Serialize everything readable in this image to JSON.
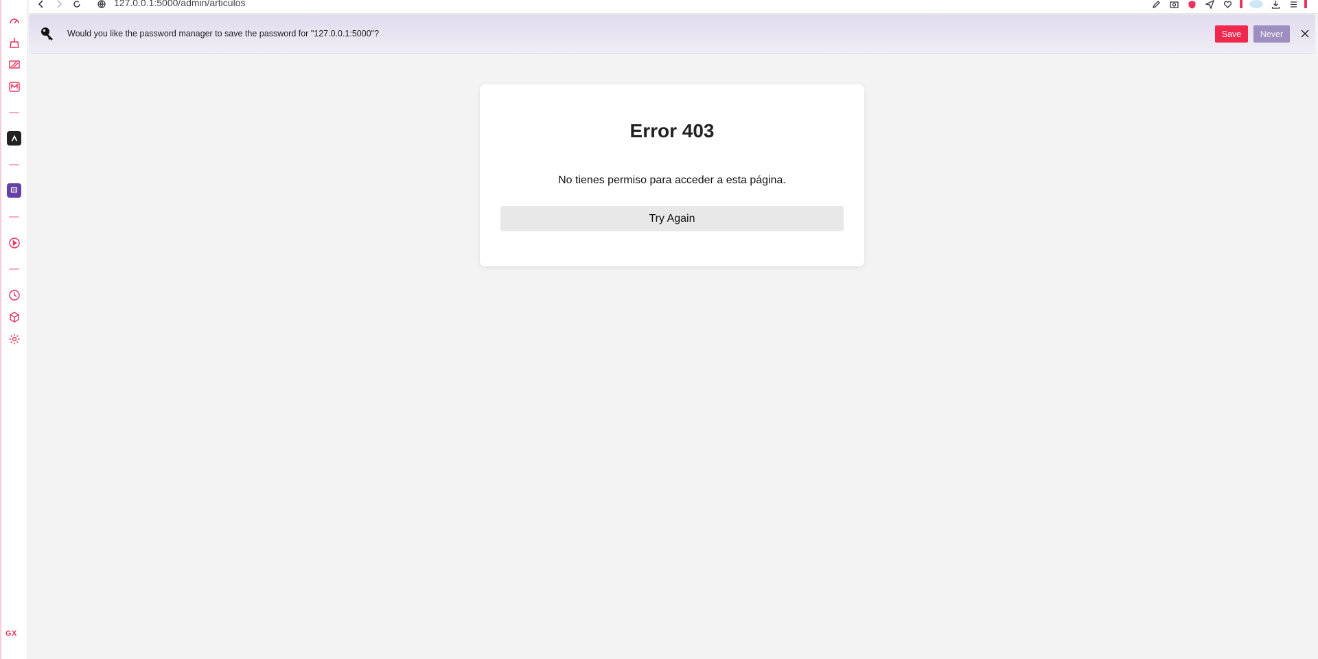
{
  "browser": {
    "url": "127.0.0.1:5000/admin/articulos",
    "accent_color": "#e8355f"
  },
  "sidebar": {
    "items": [
      {
        "icon": "speed-dial-icon"
      },
      {
        "icon": "cleaner-icon"
      },
      {
        "icon": "gx-corner-icon"
      },
      {
        "icon": "music-player-icon"
      },
      {
        "icon": "aria-app-icon"
      },
      {
        "icon": "twitch-icon"
      },
      {
        "icon": "player-icon"
      },
      {
        "icon": "history-icon"
      },
      {
        "icon": "extensions-icon"
      },
      {
        "icon": "settings-icon"
      }
    ],
    "footer_label": "GX"
  },
  "password_bar": {
    "message": "Would you like the password manager to save the password for \"127.0.0.1:5000\"?",
    "save_label": "Save",
    "never_label": "Never",
    "save_color": "#f0284e",
    "never_color": "#9d8ebf"
  },
  "error_card": {
    "title": "Error 403",
    "message": "No tienes permiso para acceder a esta página.",
    "button_label": "Try Again"
  }
}
